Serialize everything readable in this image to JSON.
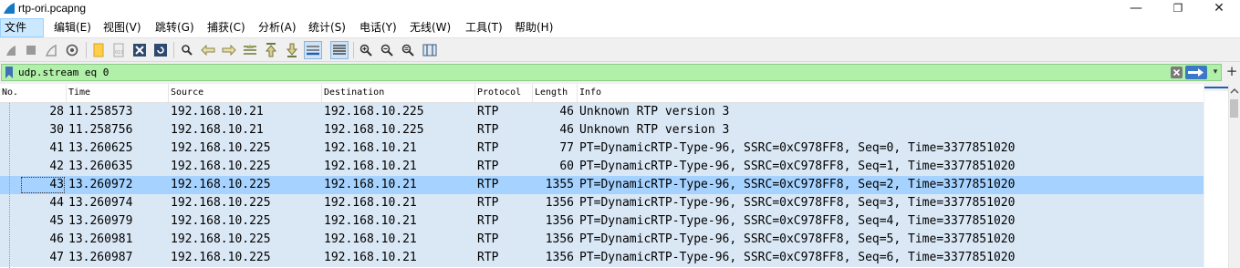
{
  "window": {
    "title": "rtp-ori.pcapng",
    "minimize_glyph": "—",
    "maximize_glyph": "❐",
    "close_glyph": "✕"
  },
  "menu": [
    {
      "label": "文件(F)",
      "icon": ""
    },
    {
      "label": "编辑(E)"
    },
    {
      "label": "视图(V)"
    },
    {
      "label": "跳转(G)"
    },
    {
      "label": "捕获(C)"
    },
    {
      "label": "分析(A)"
    },
    {
      "label": "统计(S)"
    },
    {
      "label": "电话(Y)"
    },
    {
      "label": "无线(W)"
    },
    {
      "label": "工具(T)"
    },
    {
      "label": "帮助(H)"
    }
  ],
  "toolbar": {
    "buttons": [
      "start-capture-icon",
      "stop-capture-icon",
      "restart-capture-icon",
      "capture-options-icon",
      "open-file-icon",
      "save-file-icon",
      "close-file-icon",
      "reload-file-icon",
      "find-packet-icon",
      "go-back-icon",
      "go-forward-icon",
      "go-to-packet-icon",
      "first-packet-icon",
      "last-packet-icon",
      "auto-scroll-icon",
      "colorize-icon",
      "zoom-in-icon",
      "zoom-out-icon",
      "zoom-normal-icon",
      "resize-columns-icon"
    ]
  },
  "filter": {
    "value": "udp.stream eq 0",
    "dropdown_glyph": "▾",
    "add_glyph": "+"
  },
  "columns": [
    "No.",
    "Time",
    "Source",
    "Destination",
    "Protocol",
    "Length",
    "Info"
  ],
  "packets": [
    {
      "no": "28",
      "time": "11.258573",
      "source": "192.168.10.21",
      "destination": "192.168.10.225",
      "protocol": "RTP",
      "length": "46",
      "info": "Unknown RTP version 3"
    },
    {
      "no": "30",
      "time": "11.258756",
      "source": "192.168.10.21",
      "destination": "192.168.10.225",
      "protocol": "RTP",
      "length": "46",
      "info": "Unknown RTP version 3"
    },
    {
      "no": "41",
      "time": "13.260625",
      "source": "192.168.10.225",
      "destination": "192.168.10.21",
      "protocol": "RTP",
      "length": "77",
      "info": "PT=DynamicRTP-Type-96, SSRC=0xC978FF8, Seq=0, Time=3377851020"
    },
    {
      "no": "42",
      "time": "13.260635",
      "source": "192.168.10.225",
      "destination": "192.168.10.21",
      "protocol": "RTP",
      "length": "60",
      "info": "PT=DynamicRTP-Type-96, SSRC=0xC978FF8, Seq=1, Time=3377851020"
    },
    {
      "no": "43",
      "time": "13.260972",
      "source": "192.168.10.225",
      "destination": "192.168.10.21",
      "protocol": "RTP",
      "length": "1355",
      "info": "PT=DynamicRTP-Type-96, SSRC=0xC978FF8, Seq=2, Time=3377851020",
      "selected": true
    },
    {
      "no": "44",
      "time": "13.260974",
      "source": "192.168.10.225",
      "destination": "192.168.10.21",
      "protocol": "RTP",
      "length": "1356",
      "info": "PT=DynamicRTP-Type-96, SSRC=0xC978FF8, Seq=3, Time=3377851020"
    },
    {
      "no": "45",
      "time": "13.260979",
      "source": "192.168.10.225",
      "destination": "192.168.10.21",
      "protocol": "RTP",
      "length": "1356",
      "info": "PT=DynamicRTP-Type-96, SSRC=0xC978FF8, Seq=4, Time=3377851020"
    },
    {
      "no": "46",
      "time": "13.260981",
      "source": "192.168.10.225",
      "destination": "192.168.10.21",
      "protocol": "RTP",
      "length": "1356",
      "info": "PT=DynamicRTP-Type-96, SSRC=0xC978FF8, Seq=5, Time=3377851020"
    },
    {
      "no": "47",
      "time": "13.260987",
      "source": "192.168.10.225",
      "destination": "192.168.10.21",
      "protocol": "RTP",
      "length": "1356",
      "info": "PT=DynamicRTP-Type-96, SSRC=0xC978FF8, Seq=6, Time=3377851020"
    }
  ],
  "colors": {
    "row_background": "#dae8f6",
    "selected_row": "#a6d2ff",
    "filter_valid": "#b0f0a8"
  }
}
